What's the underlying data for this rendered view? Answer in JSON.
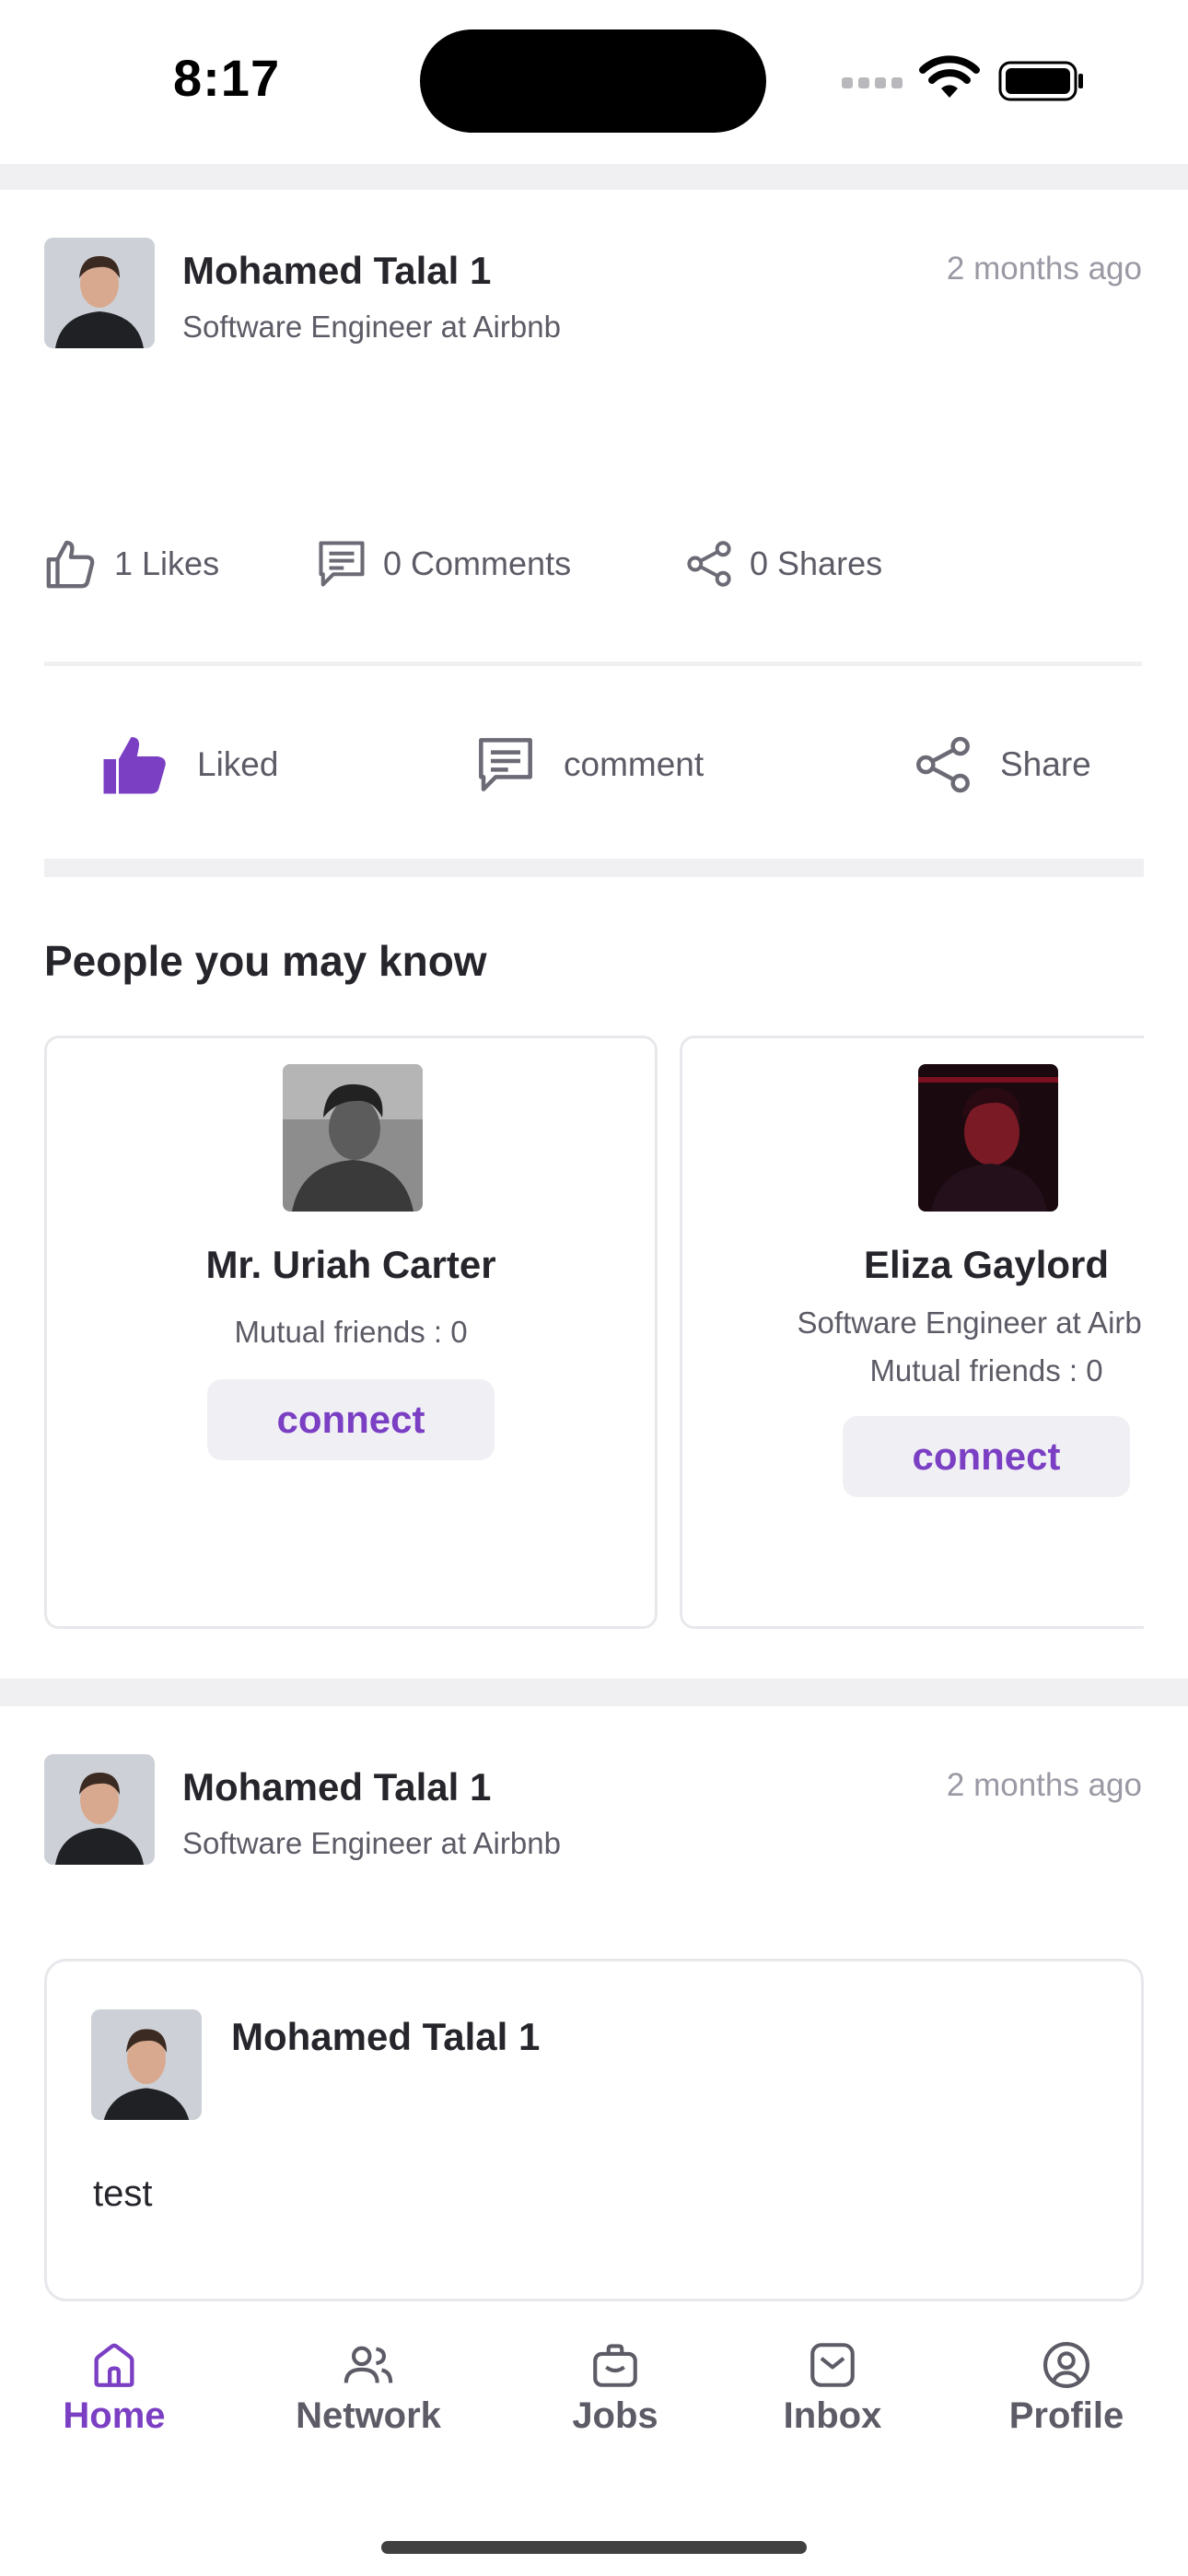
{
  "status_bar": {
    "time": "8:17"
  },
  "colors": {
    "accent": "#7b3fc4",
    "text": "#26252b",
    "muted": "#5c5b66",
    "band": "#f0f0f3"
  },
  "post1": {
    "author_name": "Mohamed Talal 1",
    "author_title": "Software Engineer at Airbnb",
    "time": "2 months ago",
    "stats": {
      "likes": "1 Likes",
      "comments": "0 Comments",
      "shares": "0 Shares"
    },
    "actions": {
      "like": "Liked",
      "comment": "comment",
      "share": "Share"
    }
  },
  "pymk": {
    "title": "People you may know",
    "people": [
      {
        "name": "Mr. Uriah Carter",
        "subtitle": "",
        "mutual": "Mutual friends  : 0",
        "connect_label": "connect"
      },
      {
        "name": "Eliza Gaylord",
        "subtitle": "Software Engineer at Airbnb",
        "mutual": "Mutual friends  : 0",
        "connect_label": "connect"
      }
    ]
  },
  "post2": {
    "author_name": "Mohamed Talal 1",
    "author_title": "Software Engineer at Airbnb",
    "time": "2 months ago",
    "shared": {
      "author_name": "Mohamed Talal 1",
      "body": "test"
    }
  },
  "bottom_nav": {
    "items": [
      {
        "label": "Home",
        "icon": "home-icon",
        "active": true
      },
      {
        "label": "Network",
        "icon": "network-icon",
        "active": false
      },
      {
        "label": "Jobs",
        "icon": "jobs-icon",
        "active": false
      },
      {
        "label": "Inbox",
        "icon": "inbox-icon",
        "active": false
      },
      {
        "label": "Profile",
        "icon": "profile-icon",
        "active": false
      }
    ]
  }
}
